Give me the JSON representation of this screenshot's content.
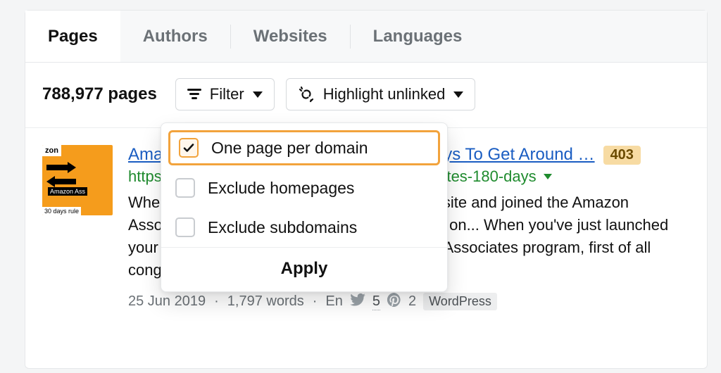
{
  "tabs": {
    "pages": "Pages",
    "authors": "Authors",
    "websites": "Websites",
    "languages": "Languages"
  },
  "toolbar": {
    "count_label": "788,977 pages",
    "filter_label": "Filter",
    "highlight_label": "Highlight unlinked"
  },
  "filter_panel": {
    "one_page_per_domain": "One page per domain",
    "exclude_homepages": "Exclude homepages",
    "exclude_subdomains": "Exclude subdomains",
    "apply_label": "Apply"
  },
  "result": {
    "title": "Amazon Associates 180 Days Rule | 5 Ways To Get Around …",
    "badge": "403",
    "url": "https://oneminuteenglish.com/amazon-associates-180-days",
    "snippet": "When you've just launched your very first website and joined the Amazon Associates program, first of all congratulations on... When you've just launched your very first website and joined the Amazon Associates program, first of all congratulations on your",
    "meta": {
      "date": "25 Jun 2019",
      "words": "1,797 words",
      "lang": "En",
      "twitter_count": "5",
      "pinterest_count": "2",
      "tag": "WordPress"
    },
    "thumb": {
      "top_label": "zon",
      "mid_label": "Amazon Ass",
      "bottom_label": "30 days rule"
    }
  }
}
